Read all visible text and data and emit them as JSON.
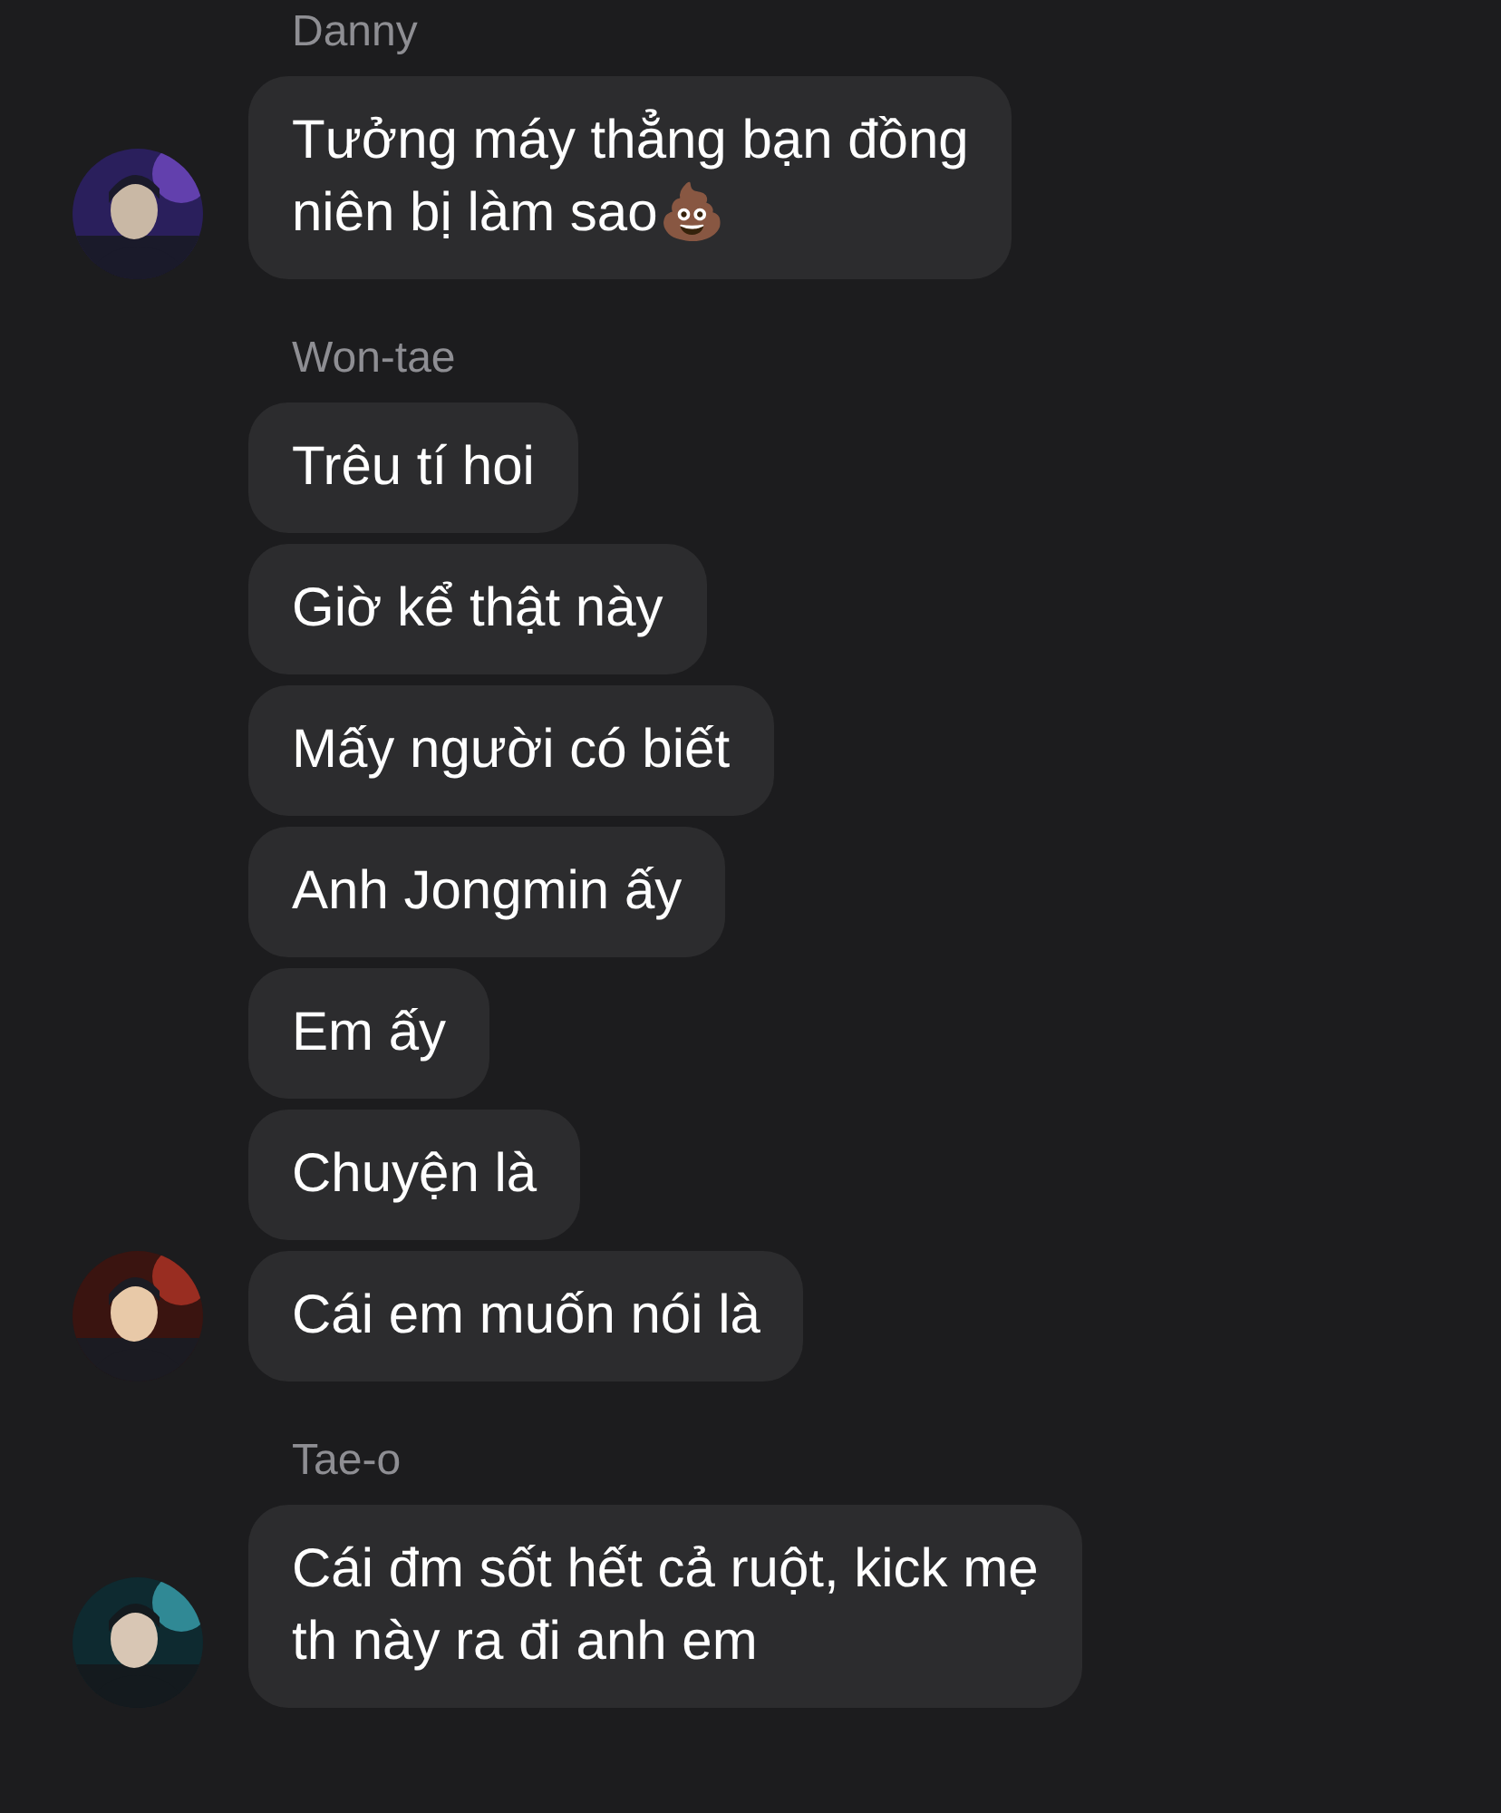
{
  "groups": [
    {
      "sender": "Danny",
      "messages": [
        "Tưởng máy thẳng bạn đồng\nniên bị làm sao💩"
      ]
    },
    {
      "sender": "Won-tae",
      "messages": [
        "Trêu tí hoi",
        "Giờ kể thật này",
        "Mấy người có biết",
        "Anh Jongmin ấy",
        "Em ấy",
        "Chuyện là",
        "Cái em muốn nói là"
      ]
    },
    {
      "sender": "Tae-o",
      "messages": [
        "Cái đm sốt hết cả ruột, kick mẹ\nth này ra đi anh em"
      ]
    }
  ]
}
